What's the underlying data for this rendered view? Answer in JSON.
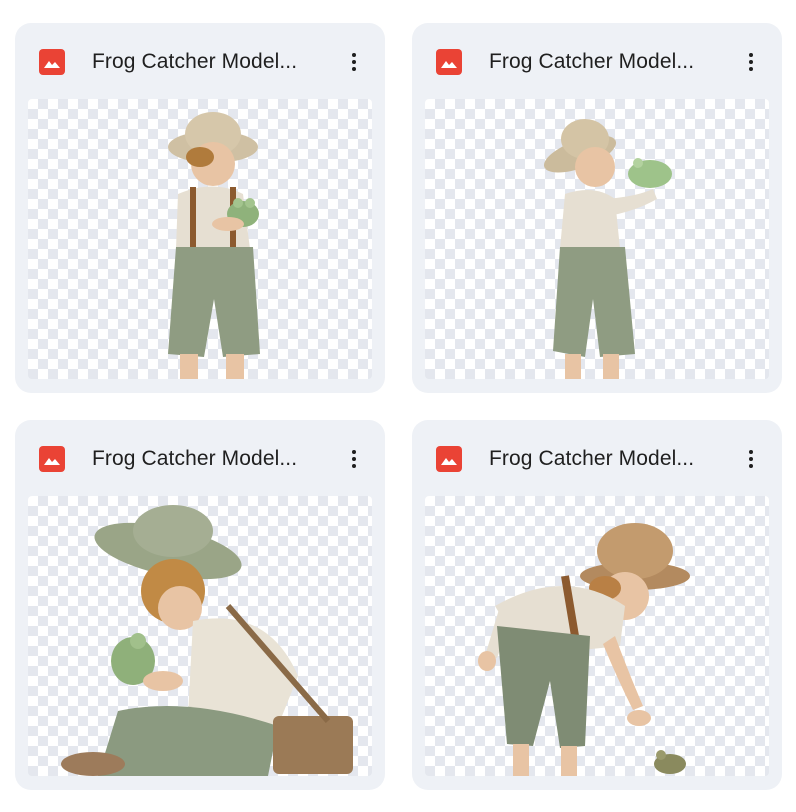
{
  "files": [
    {
      "title": "Frog Catcher Model...",
      "type_icon": "image-file-icon",
      "menu_icon": "more-vert-icon"
    },
    {
      "title": "Frog Catcher Model...",
      "type_icon": "image-file-icon",
      "menu_icon": "more-vert-icon"
    },
    {
      "title": "Frog Catcher Model...",
      "type_icon": "image-file-icon",
      "menu_icon": "more-vert-icon"
    },
    {
      "title": "Frog Catcher Model...",
      "type_icon": "image-file-icon",
      "menu_icon": "more-vert-icon"
    }
  ],
  "colors": {
    "card_bg": "#eef1f6",
    "file_icon": "#ea4335",
    "title_text": "#1f1f1f",
    "checker": "#e4e7ee"
  }
}
